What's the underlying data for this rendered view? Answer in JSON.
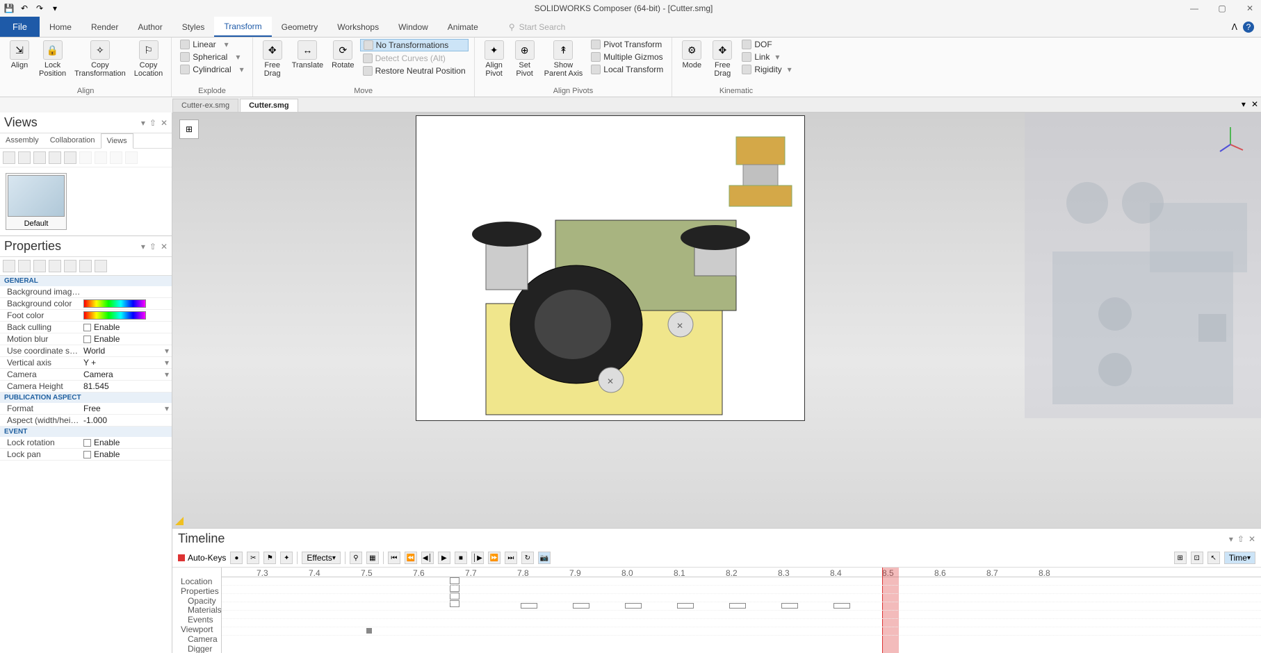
{
  "titlebar": {
    "title": "SOLIDWORKS Composer (64-bit) - [Cutter.smg]"
  },
  "menu": {
    "file": "File",
    "tabs": [
      "Home",
      "Render",
      "Author",
      "Styles",
      "Transform",
      "Geometry",
      "Workshops",
      "Window",
      "Animate"
    ],
    "active_tab": "Transform",
    "search_placeholder": "Start Search"
  },
  "ribbon": {
    "groups": {
      "align": {
        "label": "Align",
        "align": "Align",
        "lock_position": "Lock\nPosition",
        "copy_transformation": "Copy\nTransformation",
        "copy_location": "Copy\nLocation"
      },
      "explode": {
        "label": "Explode",
        "linear": "Linear",
        "spherical": "Spherical",
        "cylindrical": "Cylindrical"
      },
      "move": {
        "label": "Move",
        "free_drag": "Free\nDrag",
        "translate": "Translate",
        "rotate": "Rotate",
        "no_transformations": "No Transformations",
        "detect_curves": "Detect Curves (Alt)",
        "restore": "Restore Neutral Position"
      },
      "align_pivots": {
        "label": "Align Pivots",
        "align_pivot": "Align\nPivot",
        "set_pivot": "Set\nPivot",
        "show_parent_axis": "Show\nParent Axis",
        "pivot_transform": "Pivot Transform",
        "multiple_gizmos": "Multiple Gizmos",
        "local_transform": "Local Transform"
      },
      "kinematic": {
        "label": "Kinematic",
        "mode": "Mode",
        "free_drag": "Free\nDrag",
        "dof": "DOF",
        "link": "Link",
        "rigidity": "Rigidity"
      }
    }
  },
  "doctabs": {
    "tabs": [
      {
        "label": "Cutter-ex.smg",
        "active": false
      },
      {
        "label": "Cutter.smg",
        "active": true
      }
    ]
  },
  "views": {
    "title": "Views",
    "tabs": [
      "Assembly",
      "Collaboration",
      "Views"
    ],
    "active_tab": "Views",
    "thumb_label": "Default"
  },
  "properties": {
    "title": "Properties",
    "sections": {
      "general": "GENERAL",
      "publication": "PUBLICATION ASPECT",
      "event": "EVENT"
    },
    "rows": {
      "bg_image": {
        "k": "Background image ...",
        "v": ""
      },
      "bg_color": {
        "k": "Background color",
        "v": ""
      },
      "foot_color": {
        "k": "Foot color",
        "v": ""
      },
      "back_culling": {
        "k": "Back culling",
        "v": "Enable"
      },
      "motion_blur": {
        "k": "Motion blur",
        "v": "Enable"
      },
      "coord_syst": {
        "k": "Use coordinate syst...",
        "v": "World"
      },
      "vert_axis": {
        "k": "Vertical axis",
        "v": "Y +"
      },
      "camera": {
        "k": "Camera",
        "v": "Camera"
      },
      "camera_height": {
        "k": "Camera Height",
        "v": "81.545"
      },
      "format": {
        "k": "Format",
        "v": "Free"
      },
      "aspect": {
        "k": "Aspect (width/height)",
        "v": "-1.000"
      },
      "lock_rotation": {
        "k": "Lock rotation",
        "v": "Enable"
      },
      "lock_pan": {
        "k": "Lock pan",
        "v": "Enable"
      }
    }
  },
  "timeline": {
    "title": "Timeline",
    "auto_keys": "Auto-Keys",
    "effects": "Effects",
    "time_label": "Time",
    "ruler_ticks": [
      "7.3",
      "7.4",
      "7.5",
      "7.6",
      "7.7",
      "7.8",
      "7.9",
      "8.0",
      "8.1",
      "8.2",
      "8.3",
      "8.4",
      "8.5",
      "8.6",
      "8.7",
      "8.8"
    ],
    "playhead_value": "8.5",
    "tracks": [
      "Location",
      "Properties",
      "Opacity",
      "Materials",
      "Events",
      "Viewport",
      "Camera",
      "Digger"
    ]
  }
}
